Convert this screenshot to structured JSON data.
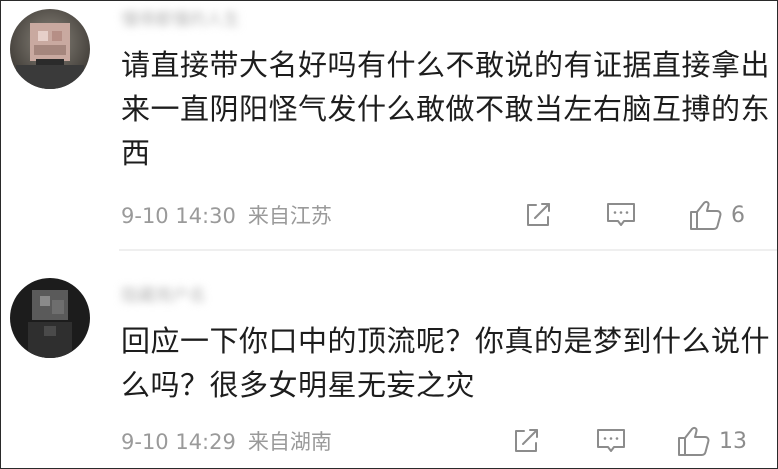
{
  "comments": [
    {
      "username": "懂得都懂的人生",
      "text": "请直接带大名好吗有什么不敢说的有证据直接拿出来一直阴阳怪气发什么敢做不敢当左右脑互搏的东西",
      "time": "9-10 14:30",
      "location": "来自江苏",
      "likes": "6"
    },
    {
      "username": "隐藏用户名",
      "text": "回应一下你口中的顶流呢？你真的是梦到什么说什么吗？很多女明星无妄之灾",
      "time": "9-10 14:29",
      "location": "来自湖南",
      "likes": "13"
    }
  ],
  "icons": {
    "share": "share-icon",
    "reply": "comment-icon",
    "like": "thumbs-up-icon"
  },
  "colors": {
    "text": "#1d1d1d",
    "meta": "#9a9a9a",
    "icon": "#8c8c8c"
  }
}
